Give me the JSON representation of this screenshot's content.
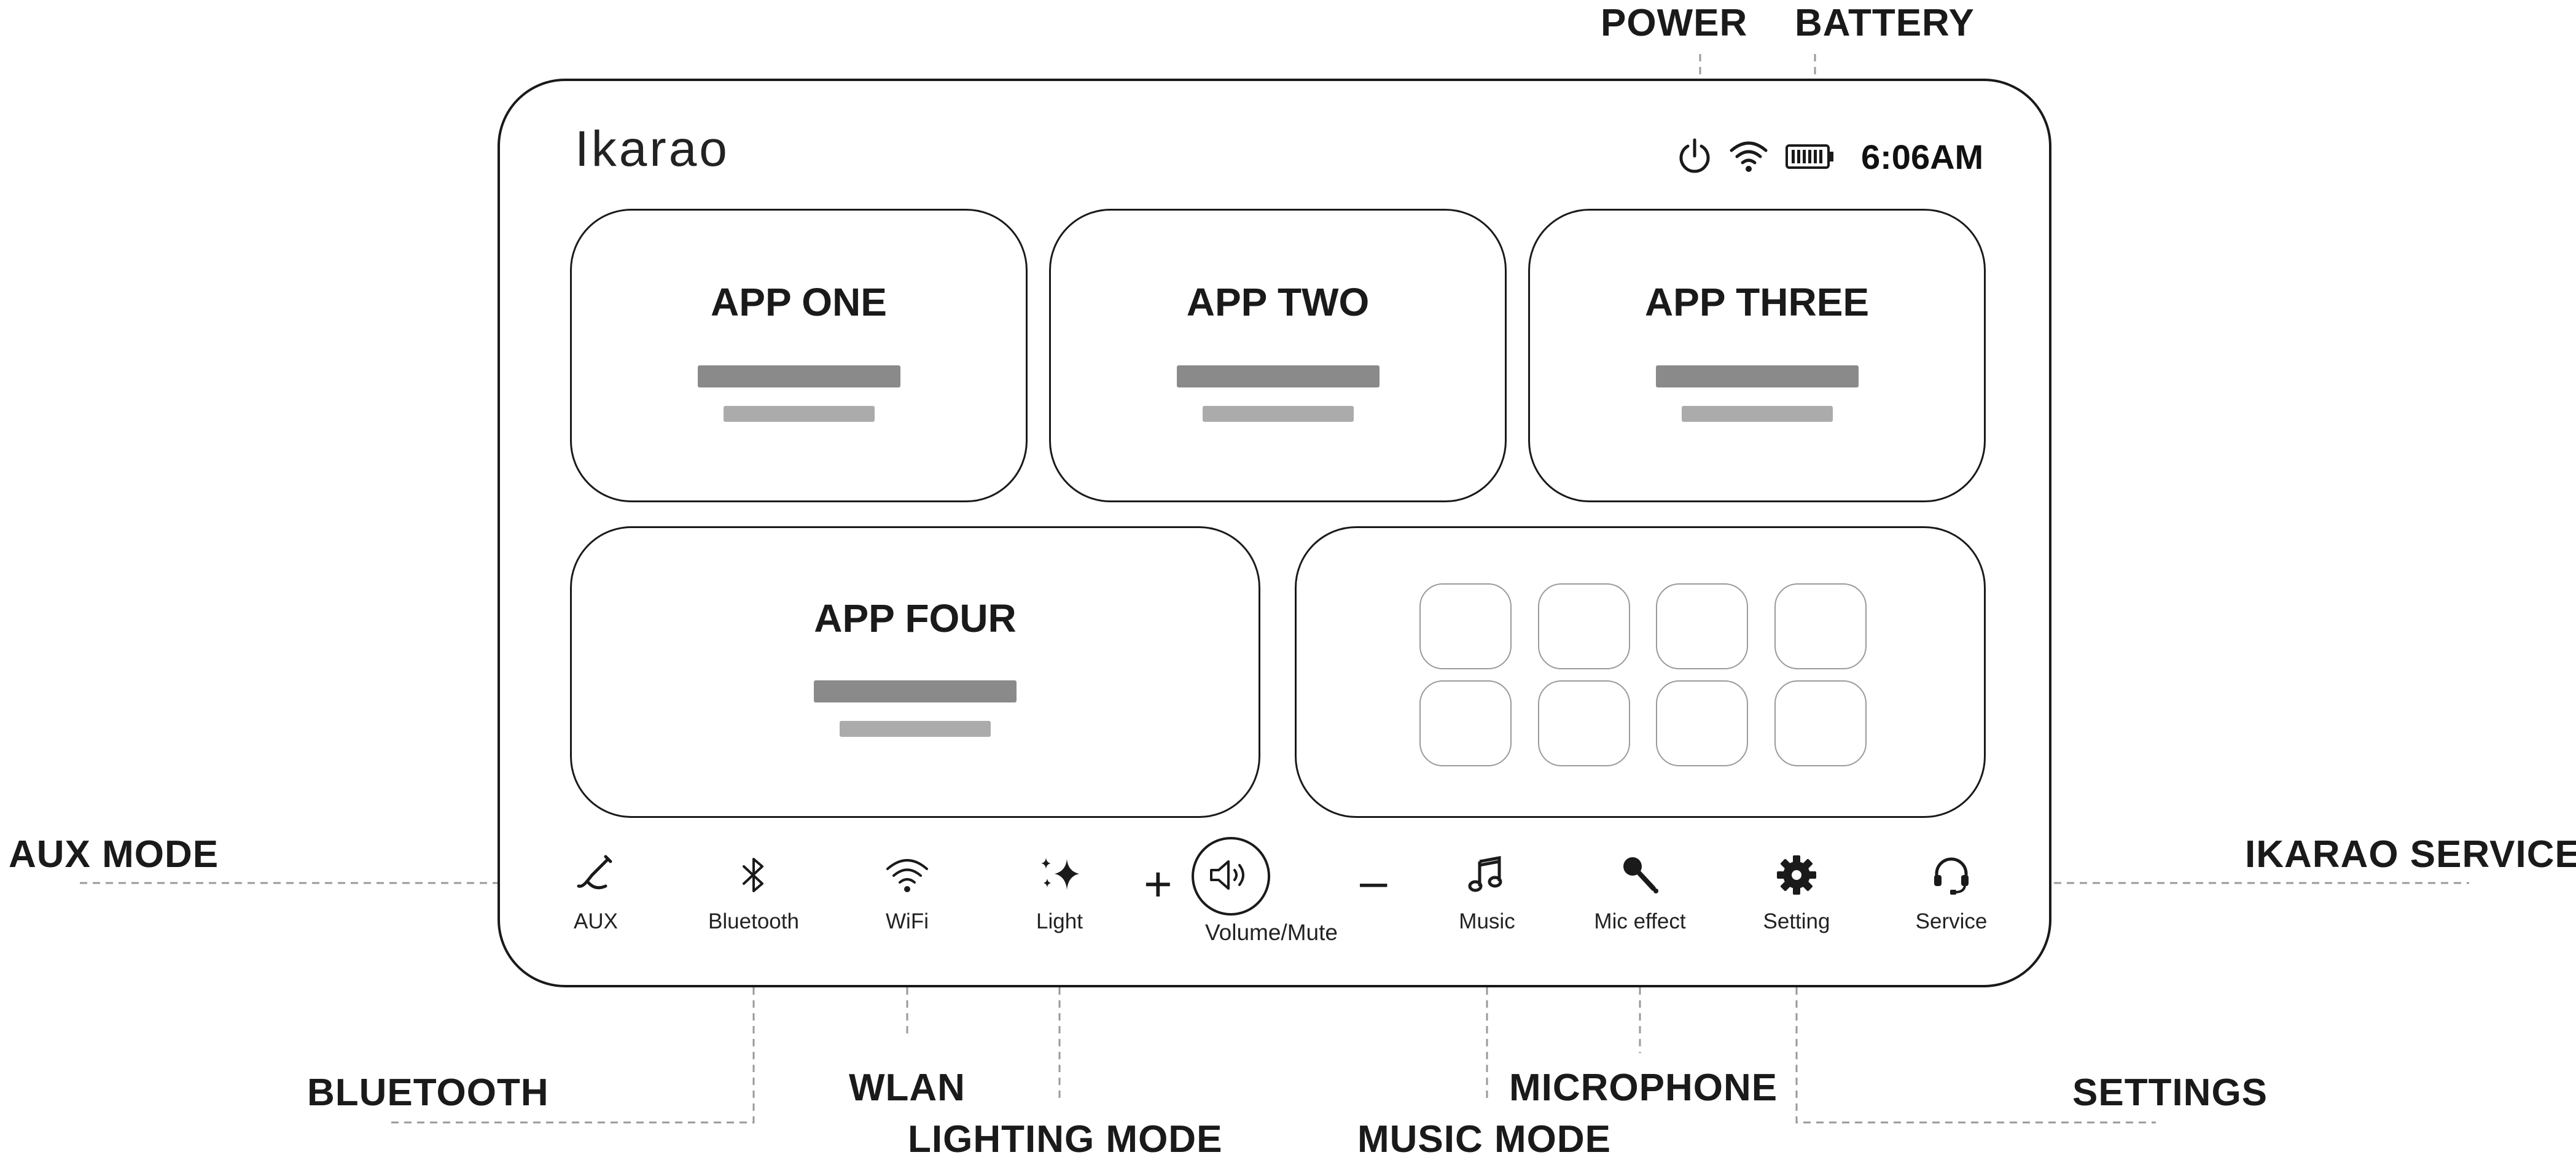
{
  "device": {
    "brand": "Ikarao",
    "status": {
      "icons": [
        "power-icon",
        "wifi-icon",
        "battery-icon"
      ],
      "time": "6:06AM"
    },
    "apps": [
      {
        "title": "APP ONE"
      },
      {
        "title": "APP TWO"
      },
      {
        "title": "APP THREE"
      },
      {
        "title": "APP FOUR"
      }
    ],
    "grid_tile_count": 8,
    "dock": {
      "aux": {
        "label": "AUX",
        "icon": "aux-cable-icon"
      },
      "bluetooth": {
        "label": "Bluetooth",
        "icon": "bluetooth-icon"
      },
      "wifi": {
        "label": "WiFi",
        "icon": "wifi-icon"
      },
      "light": {
        "label": "Light",
        "icon": "sparkle-icon"
      },
      "volume_up": {
        "label": "+",
        "icon": "plus-icon"
      },
      "volume": {
        "label": "Volume/Mute",
        "icon": "speaker-icon"
      },
      "volume_down": {
        "label": "–",
        "icon": "minus-icon"
      },
      "music": {
        "label": "Music",
        "icon": "music-note-icon"
      },
      "mic": {
        "label": "Mic effect",
        "icon": "microphone-icon"
      },
      "setting": {
        "label": "Setting",
        "icon": "gear-icon"
      },
      "service": {
        "label": "Service",
        "icon": "headset-icon"
      }
    }
  },
  "callouts": {
    "power": "POWER",
    "battery": "BATTERY",
    "aux_mode": "AUX MODE",
    "ikarao_service": "IKARAO SERVICE",
    "bluetooth": "BLUETOOTH",
    "wlan": "WLAN",
    "lighting_mode": "LIGHTING MODE",
    "music_mode": "MUSIC MODE",
    "microphone": "MICROPHONE",
    "settings": "SETTINGS"
  },
  "colors": {
    "outline": "#1a1a1a",
    "leader": "#9a9a9a",
    "bar_dark": "#8a8a8a",
    "bar_light": "#ababab",
    "tile_border": "#9a9a9a"
  }
}
